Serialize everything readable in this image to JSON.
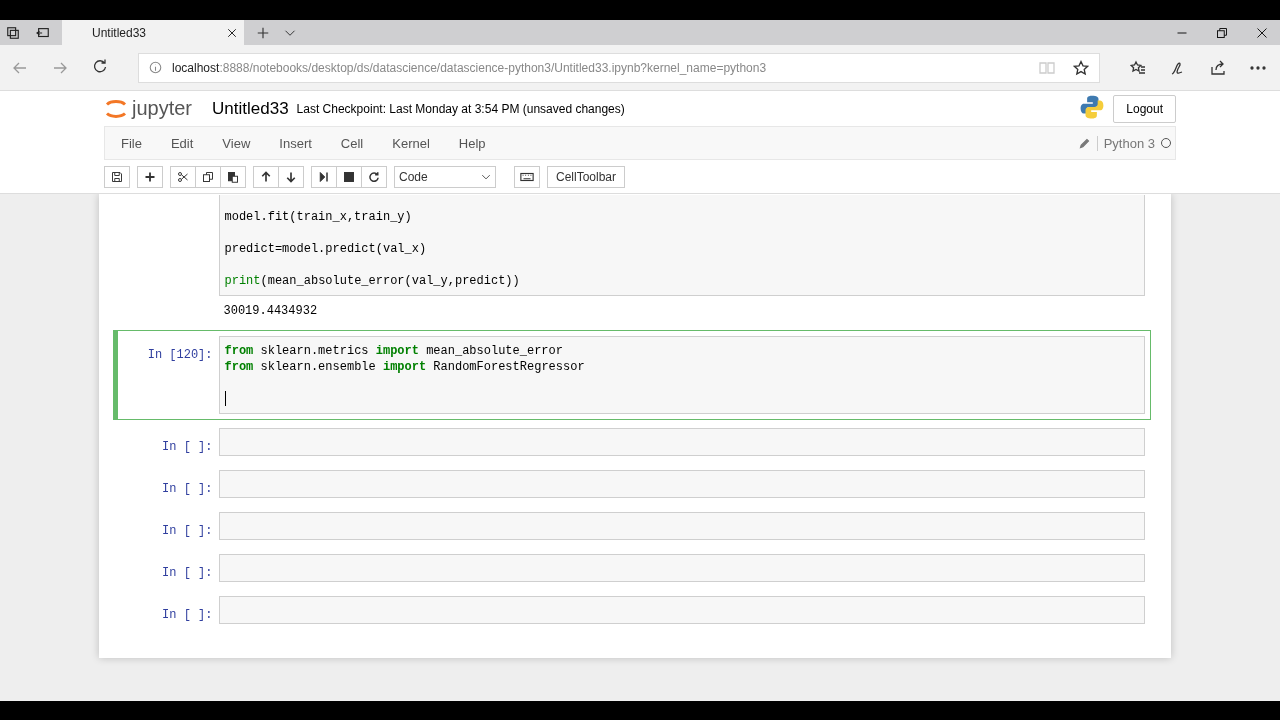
{
  "browser": {
    "tab_title": "Untitled33",
    "url_host": "localhost",
    "url_path": ":8888/notebooks/desktop/ds/datascience/datascience-python3/Untitled33.ipynb?kernel_name=python3"
  },
  "header": {
    "logo_text": "jupyter",
    "notebook_title": "Untitled33",
    "checkpoint": "Last Checkpoint: Last Monday at 3:54 PM (unsaved changes)",
    "logout": "Logout"
  },
  "menu": [
    "File",
    "Edit",
    "View",
    "Insert",
    "Cell",
    "Kernel",
    "Help"
  ],
  "kernel": {
    "name": "Python 3",
    "busy": false
  },
  "toolbar": {
    "cell_type": "Code",
    "celltoolbar": "CellToolbar"
  },
  "cells": [
    {
      "selected": false,
      "blank_lines_between": true,
      "lines": [
        [
          {
            "kind": "plain",
            "text": "model.fit(train_x,train_y)"
          }
        ],
        [
          {
            "kind": "plain",
            "text": "predict=model.predict(val_x)"
          }
        ],
        [
          {
            "kind": "builtin",
            "text": "print"
          },
          {
            "kind": "plain",
            "text": "(mean_absolute_error(val_y,predict))"
          }
        ]
      ],
      "cursor": false,
      "output": "30019.4434932"
    },
    {
      "selected": true,
      "blank_lines_between": false,
      "prompt": "In [120]:",
      "lines": [
        [
          {
            "kind": "keyword",
            "text": "from"
          },
          {
            "kind": "plain",
            "text": " sklearn.metrics "
          },
          {
            "kind": "keyword",
            "text": "import"
          },
          {
            "kind": "plain",
            "text": " mean_absolute_error"
          }
        ],
        [
          {
            "kind": "keyword",
            "text": "from"
          },
          {
            "kind": "plain",
            "text": " sklearn.ensemble "
          },
          {
            "kind": "keyword",
            "text": "import"
          },
          {
            "kind": "plain",
            "text": " RandomForestRegressor"
          }
        ]
      ],
      "cursor": true
    },
    {
      "selected": false,
      "prompt": "In [ ]:",
      "cursor": false
    },
    {
      "selected": false,
      "prompt": "In [ ]:",
      "cursor": false
    },
    {
      "selected": false,
      "prompt": "In [ ]:",
      "cursor": false
    },
    {
      "selected": false,
      "prompt": "In [ ]:",
      "cursor": false
    },
    {
      "selected": false,
      "prompt": "In [ ]:",
      "cursor": false
    }
  ]
}
